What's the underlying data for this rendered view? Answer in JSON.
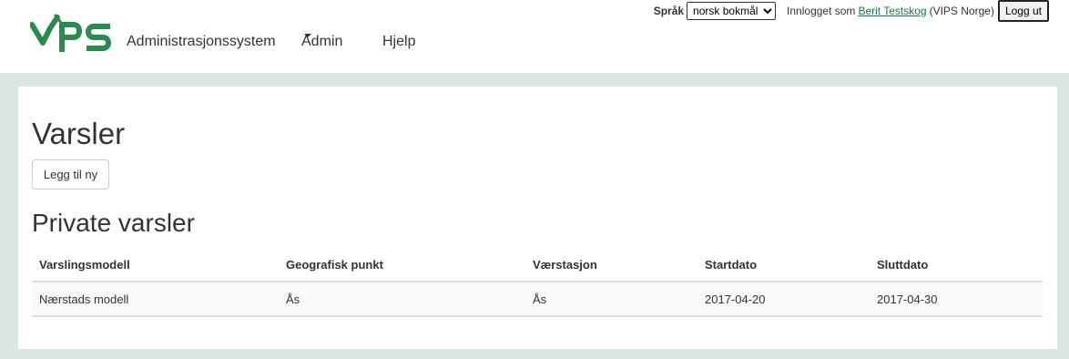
{
  "header": {
    "nav": {
      "brand": "Administrasjonssystem",
      "admin": "Admin",
      "help": "Hjelp"
    },
    "language": {
      "label": "Språk",
      "selected": "norsk bokmål"
    },
    "user": {
      "prefix": "Innlogget som",
      "name": "Berit Testskog",
      "org": "(VIPS Norge)"
    },
    "logout_label": "Logg ut",
    "brand_color": "#2d8a4e"
  },
  "main": {
    "title": "Varsler",
    "add_button": "Legg til ny",
    "private_title": "Private varsler",
    "table": {
      "columns": [
        "Varslingsmodell",
        "Geografisk punkt",
        "Værstasjon",
        "Startdato",
        "Sluttdato"
      ],
      "rows": [
        [
          "Nærstads modell",
          "Ås",
          "Ås",
          "2017-04-20",
          "2017-04-30"
        ]
      ]
    }
  },
  "colors": {
    "background_band": "#d9e6e3",
    "link": "#1a7a43"
  }
}
